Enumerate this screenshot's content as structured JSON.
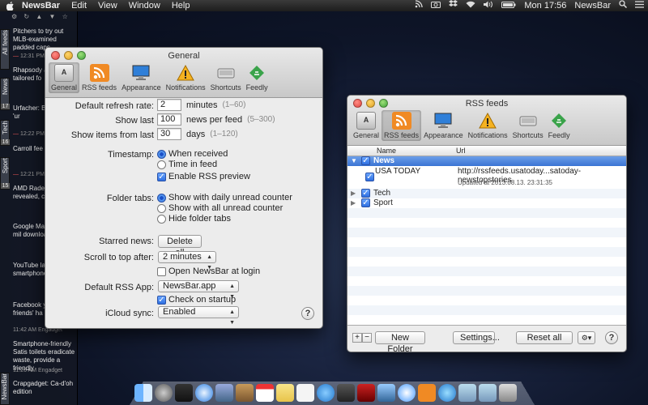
{
  "menubar": {
    "app_name": "NewsBar",
    "menus": [
      "Edit",
      "View",
      "Window",
      "Help"
    ],
    "clock": "Mon 17:56",
    "right_app": "NewsBar"
  },
  "newsbar": {
    "tabs": [
      {
        "label": "All feeds",
        "count": ""
      },
      {
        "label": "News",
        "count": "17"
      },
      {
        "label": "Tech",
        "count": "16"
      },
      {
        "label": "Sport",
        "count": "15"
      }
    ],
    "bottom_label": "NewsBar",
    "items": [
      {
        "text": "Pitchers to try out MLB-examined padded caps"
      },
      {
        "text": "Rhapsody app, co tailored fo"
      },
      {
        "text": "Urfacher: Bi at home 'ur"
      },
      {
        "text": "Carroll fee fake punt a"
      },
      {
        "text": "AMD Rade 8000M-se revealed, co"
      },
      {
        "text": "Google Ma over 10 mil downloads"
      },
      {
        "text": "YouTube la Capture i smartphone"
      },
      {
        "text": "Facebook you discove friends' ha"
      },
      {
        "text": "Smartphone-friendly Satis toilets eradicate waste, provide a friendly"
      },
      {
        "text": "Crapgadget: Ca-d'oh edition"
      }
    ],
    "times": [
      "12:31 PM",
      "12:22 PM",
      "12:21 PM",
      "11:42 AM Engadget",
      "11:26 AM Engadget"
    ]
  },
  "general": {
    "title": "General",
    "toolbar": [
      "General",
      "RSS feeds",
      "Appearance",
      "Notifications",
      "Shortcuts",
      "Feedly"
    ],
    "refresh_label": "Default refresh rate:",
    "refresh_value": "2",
    "refresh_unit": "minutes",
    "refresh_hint": "(1–60)",
    "showlast_label": "Show last",
    "showlast_value": "100",
    "showlast_unit": "news per feed",
    "showlast_hint": "(5–300)",
    "showfrom_label": "Show items from last",
    "showfrom_value": "30",
    "showfrom_unit": "days",
    "showfrom_hint": "(1–120)",
    "timestamp_label": "Timestamp:",
    "timestamp_opt1": "When received",
    "timestamp_opt2": "Time in feed",
    "rss_preview": "Enable RSS preview",
    "folder_label": "Folder tabs:",
    "folder_opt1": "Show with daily unread counter",
    "folder_opt2": "Show with all unread counter",
    "folder_opt3": "Hide folder tabs",
    "starred_label": "Starred news:",
    "starred_btn": "Delete all",
    "scroll_label": "Scroll to top after:",
    "scroll_value": "2 minutes",
    "open_login": "Open NewsBar at login",
    "default_app_label": "Default RSS App:",
    "default_app_value": "NewsBar.app",
    "check_startup": "Check on startup",
    "icloud_label": "iCloud sync:",
    "icloud_value": "Enabled",
    "help": "?"
  },
  "rss": {
    "title": "RSS feeds",
    "toolbar": [
      "General",
      "RSS feeds",
      "Appearance",
      "Notifications",
      "Shortcuts",
      "Feedly"
    ],
    "col_name": "Name",
    "col_url": "Url",
    "rows": [
      {
        "name": "News"
      },
      {
        "name": "USA TODAY",
        "url": "http://rssfeeds.usatoday...satoday-newstopstories",
        "updated": "Updated at 2013.08.13. 23:31:35"
      },
      {
        "name": "Tech"
      },
      {
        "name": "Sport"
      }
    ],
    "add": "+",
    "remove": "−",
    "new_folder": "New Folder",
    "settings": "Settings...",
    "reset": "Reset all",
    "gear": "⚙▾",
    "help": "?"
  },
  "colors": {
    "selection": "#3b74d4",
    "rss_orange": "#f08a24",
    "feedly_green": "#3aa34a"
  }
}
